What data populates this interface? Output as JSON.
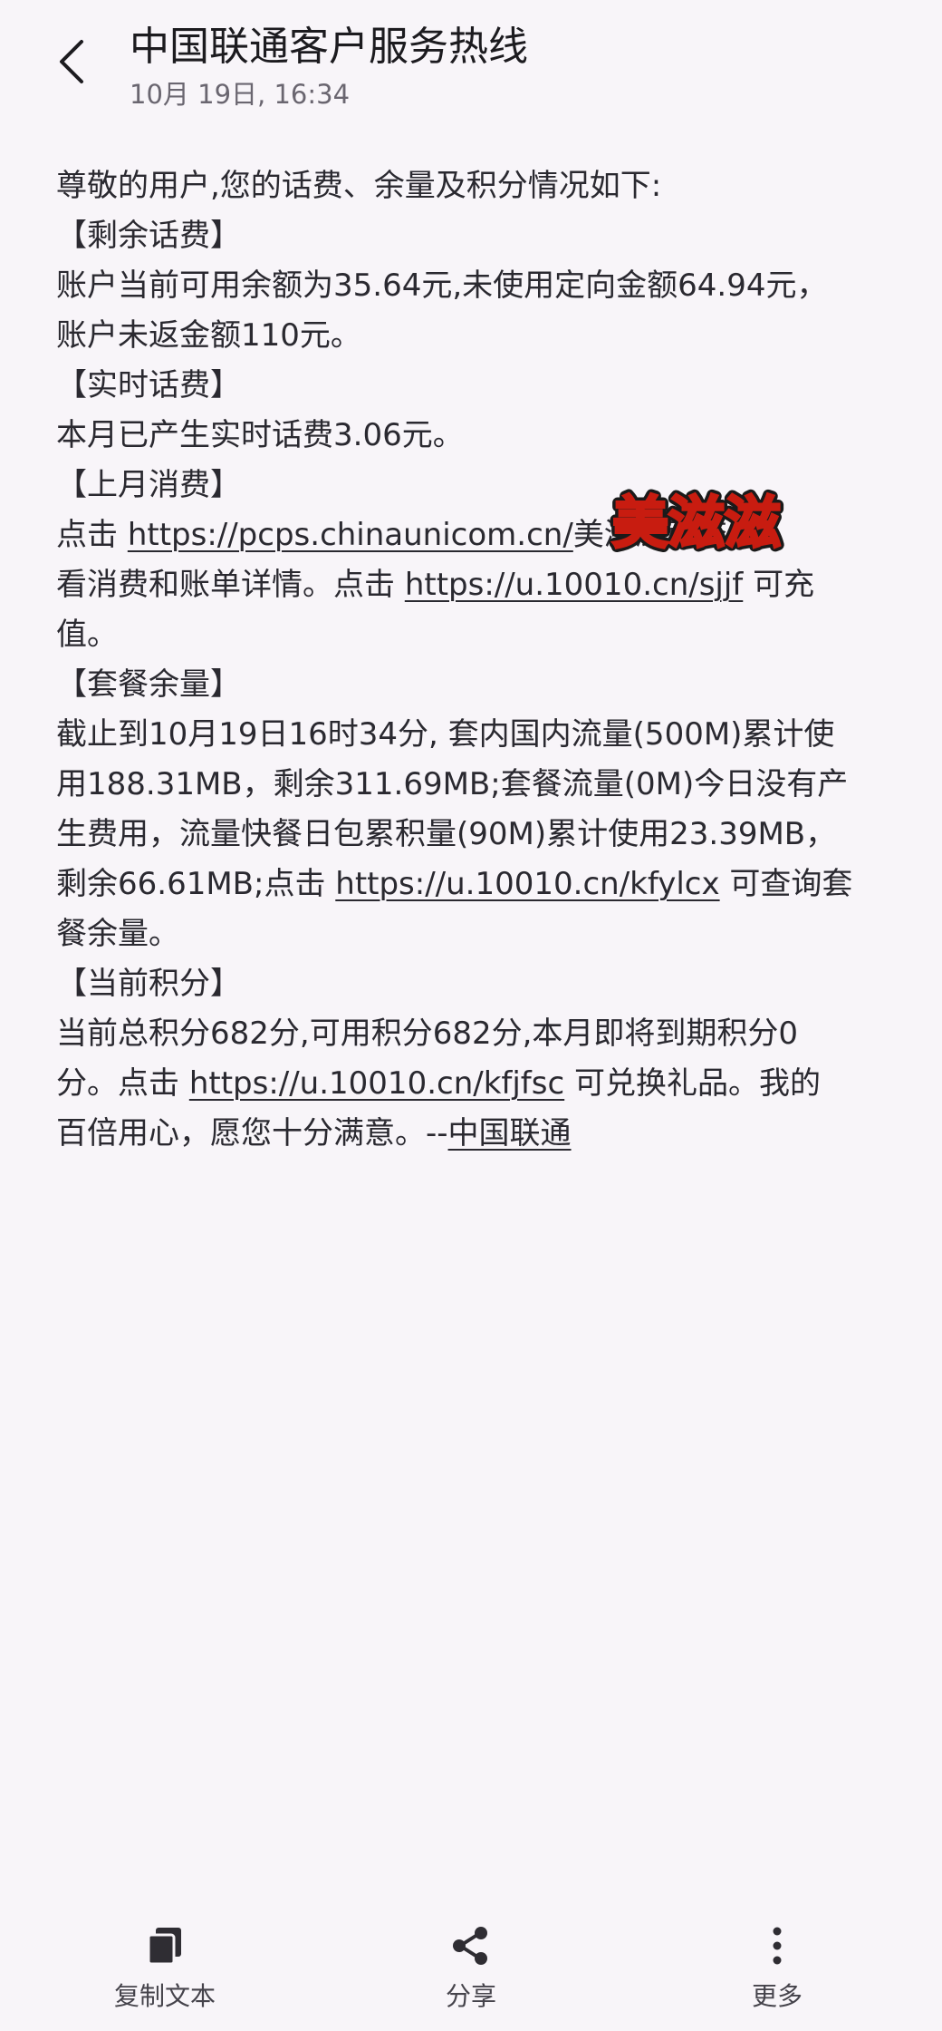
{
  "header": {
    "title": "中国联通客户服务热线",
    "timestamp": "10月 19日, 16:34"
  },
  "message": {
    "lines": [
      [
        {
          "t": "尊敬的用户,您的话费、余量及积分情况如下:"
        }
      ],
      [
        {
          "t": "【剩余话费】"
        }
      ],
      [
        {
          "t": " 账户当前可用余额为35.64元,未使用定向金额64.94元，"
        }
      ],
      [
        {
          "t": "账户未返金额110元。"
        }
      ],
      [
        {
          "t": "【实时话费】"
        }
      ],
      [
        {
          "t": " 本月已产生实时话费3.06元。"
        }
      ],
      [
        {
          "t": "【上月消费】"
        }
      ],
      [
        {
          "t": " 点击 "
        },
        {
          "t": "https://pcps.chinaunicom.cn/",
          "link": true
        },
        {
          "t": "美滋滋可查"
        }
      ],
      [
        {
          "t": "看消费和账单详情。点击 "
        },
        {
          "t": "https://u.10010.cn/sjjf",
          "link": true
        },
        {
          "t": " 可充"
        }
      ],
      [
        {
          "t": "值。"
        }
      ],
      [
        {
          "t": "【套餐余量】"
        }
      ],
      [
        {
          "t": " 截止到10月19日16时34分, 套内国内流量(500M)累计使"
        }
      ],
      [
        {
          "t": "用188.31MB，剩余311.69MB;套餐流量(0M)今日没有产"
        }
      ],
      [
        {
          "t": "生费用，流量快餐日包累积量(90M)累计使用23.39MB，"
        }
      ],
      [
        {
          "t": "剩余66.61MB;点击 "
        },
        {
          "t": "https://u.10010.cn/kfylcx",
          "link": true
        },
        {
          "t": " 可查询套"
        }
      ],
      [
        {
          "t": "餐余量。"
        }
      ],
      [
        {
          "t": "【当前积分】"
        }
      ],
      [
        {
          "t": " 当前总积分682分,可用积分682分,本月即将到期积分0"
        }
      ],
      [
        {
          "t": "分。点击 "
        },
        {
          "t": "https://u.10010.cn/kfjfsc",
          "link": true
        },
        {
          "t": " 可兑换礼品。我的"
        }
      ],
      [
        {
          "t": "百倍用心，愿您十分满意。--"
        },
        {
          "t": "中国联通",
          "link": true
        }
      ]
    ]
  },
  "sticker": {
    "text": "美滋滋"
  },
  "actions": [
    {
      "name": "copy-text-button",
      "icon": "copy-icon",
      "label": "复制文本"
    },
    {
      "name": "share-button",
      "icon": "share-icon",
      "label": "分享"
    },
    {
      "name": "more-button",
      "icon": "more-vertical-icon",
      "label": "更多"
    }
  ],
  "colors": {
    "background": "#f8f5f9",
    "text": "#2a2930",
    "secondary_text": "#6a6670"
  }
}
